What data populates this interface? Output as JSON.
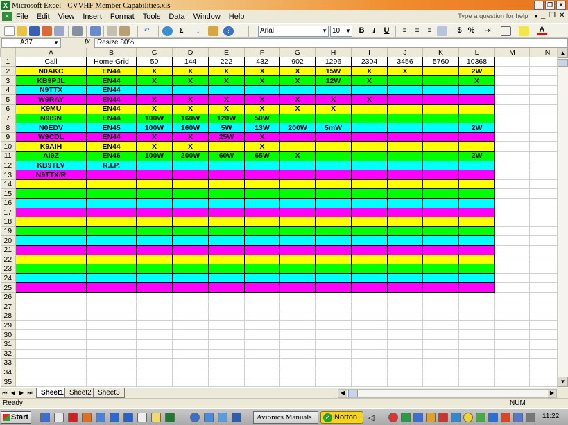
{
  "window": {
    "title": "Microsoft Excel - CVVHF Member Capabilities.xls",
    "minimize_glyph": "_",
    "restore_glyph": "❐",
    "close_glyph": "✕"
  },
  "menu": {
    "items": [
      "File",
      "Edit",
      "View",
      "Insert",
      "Format",
      "Tools",
      "Data",
      "Window",
      "Help"
    ],
    "help_placeholder": "Type a question for help"
  },
  "toolbar": {
    "font_name": "Arial",
    "font_size": "10",
    "bold_label": "B",
    "italic_label": "I",
    "underline_label": "U",
    "currency_label": "$",
    "percent_label": "%"
  },
  "formula_bar": {
    "cell_ref": "A37",
    "fx_label": "fx",
    "content": "Resize 80%"
  },
  "grid": {
    "columns": [
      "A",
      "B",
      "C",
      "D",
      "E",
      "F",
      "G",
      "H",
      "I",
      "J",
      "K",
      "L",
      "M",
      "N"
    ],
    "row_numbers": [
      "1",
      "2",
      "3",
      "4",
      "5",
      "6",
      "7",
      "8",
      "9",
      "10",
      "11",
      "12",
      "13",
      "14",
      "15",
      "16",
      "17",
      "18",
      "19",
      "20",
      "21",
      "22",
      "23",
      "24",
      "25",
      "26",
      "27",
      "28",
      "29",
      "30",
      "31",
      "32",
      "33",
      "34",
      "35"
    ],
    "colors": {
      "yellow": "#ffff00",
      "green": "#00ff00",
      "cyan": "#00ffff",
      "magenta": "#ff00ff",
      "white": "#ffffff"
    },
    "header_row": [
      "Call",
      "Home Grid",
      "50",
      "144",
      "222",
      "432",
      "902",
      "1296",
      "2304",
      "3456",
      "5760",
      "10368"
    ],
    "rows": [
      {
        "fill": "yellow",
        "cells": [
          "N0AKC",
          "EN44",
          "X",
          "X",
          "X",
          "X",
          "X",
          "15W",
          "X",
          "X",
          "",
          "2W"
        ]
      },
      {
        "fill": "green",
        "cells": [
          "KB9PJL",
          "EN44",
          "X",
          "X",
          "X",
          "X",
          "X",
          "12W",
          "X",
          "",
          "",
          "X"
        ]
      },
      {
        "fill": "cyan",
        "cells": [
          "N9TTX",
          "EN44",
          "",
          "",
          "",
          "",
          "",
          "",
          "",
          "",
          "",
          ""
        ]
      },
      {
        "fill": "magenta",
        "cells": [
          "W9RAY",
          "EN44",
          "X",
          "X",
          "X",
          "X",
          "X",
          "X",
          "X",
          "",
          "",
          ""
        ]
      },
      {
        "fill": "yellow",
        "cells": [
          "K9MU",
          "EN44",
          "X",
          "X",
          "X",
          "X",
          "X",
          "X",
          "",
          "",
          "",
          ""
        ]
      },
      {
        "fill": "green",
        "cells": [
          "N9ISN",
          "EN44",
          "100W",
          "160W",
          "120W",
          "50W",
          "",
          "",
          "",
          "",
          "",
          ""
        ]
      },
      {
        "fill": "cyan",
        "cells": [
          "N0EDV",
          "EN45",
          "100W",
          "160W",
          "5W",
          "13W",
          "200W",
          "5mW",
          "",
          "",
          "",
          "2W"
        ]
      },
      {
        "fill": "magenta",
        "cells": [
          "W9CDL",
          "EN44",
          "X",
          "X",
          "25W",
          "X",
          "",
          "",
          "",
          "",
          "",
          ""
        ]
      },
      {
        "fill": "yellow",
        "cells": [
          "K9AIH",
          "EN44",
          "X",
          "X",
          "",
          "X",
          "",
          "",
          "",
          "",
          "",
          ""
        ]
      },
      {
        "fill": "green",
        "cells": [
          "AI9Z",
          "EN46",
          "100W",
          "200W",
          "60W",
          "65W",
          "X",
          "",
          "",
          "",
          "",
          "2W"
        ]
      },
      {
        "fill": "cyan",
        "cells": [
          "KB9TLV",
          "R.I.P.",
          "",
          "",
          "",
          "",
          "",
          "",
          "",
          "",
          "",
          ""
        ]
      },
      {
        "fill": "magenta",
        "cells": [
          "N9TTX/R",
          "",
          "",
          "",
          "",
          "",
          "",
          "",
          "",
          "",
          "",
          ""
        ]
      },
      {
        "fill": "yellow",
        "cells": [
          "",
          "",
          "",
          "",
          "",
          "",
          "",
          "",
          "",
          "",
          "",
          ""
        ]
      },
      {
        "fill": "green",
        "cells": [
          "",
          "",
          "",
          "",
          "",
          "",
          "",
          "",
          "",
          "",
          "",
          ""
        ]
      },
      {
        "fill": "cyan",
        "cells": [
          "",
          "",
          "",
          "",
          "",
          "",
          "",
          "",
          "",
          "",
          "",
          ""
        ]
      },
      {
        "fill": "magenta",
        "cells": [
          "",
          "",
          "",
          "",
          "",
          "",
          "",
          "",
          "",
          "",
          "",
          ""
        ]
      },
      {
        "fill": "yellow",
        "cells": [
          "",
          "",
          "",
          "",
          "",
          "",
          "",
          "",
          "",
          "",
          "",
          ""
        ]
      },
      {
        "fill": "green",
        "cells": [
          "",
          "",
          "",
          "",
          "",
          "",
          "",
          "",
          "",
          "",
          "",
          ""
        ]
      },
      {
        "fill": "cyan",
        "cells": [
          "",
          "",
          "",
          "",
          "",
          "",
          "",
          "",
          "",
          "",
          "",
          ""
        ]
      },
      {
        "fill": "magenta",
        "cells": [
          "",
          "",
          "",
          "",
          "",
          "",
          "",
          "",
          "",
          "",
          "",
          ""
        ]
      },
      {
        "fill": "yellow",
        "cells": [
          "",
          "",
          "",
          "",
          "",
          "",
          "",
          "",
          "",
          "",
          "",
          ""
        ]
      },
      {
        "fill": "green",
        "cells": [
          "",
          "",
          "",
          "",
          "",
          "",
          "",
          "",
          "",
          "",
          "",
          ""
        ]
      },
      {
        "fill": "cyan",
        "cells": [
          "",
          "",
          "",
          "",
          "",
          "",
          "",
          "",
          "",
          "",
          "",
          ""
        ]
      },
      {
        "fill": "magenta",
        "cells": [
          "",
          "",
          "",
          "",
          "",
          "",
          "",
          "",
          "",
          "",
          "",
          ""
        ]
      }
    ]
  },
  "sheets": {
    "tabs": [
      "Sheet1",
      "Sheet2",
      "Sheet3"
    ],
    "active": "Sheet1"
  },
  "status": {
    "left": "Ready",
    "num_indicator": "NUM"
  },
  "taskbar": {
    "start_label": "Start",
    "window_button": "Avionics Manuals",
    "norton_label": "Norton",
    "clock": "11:22"
  }
}
